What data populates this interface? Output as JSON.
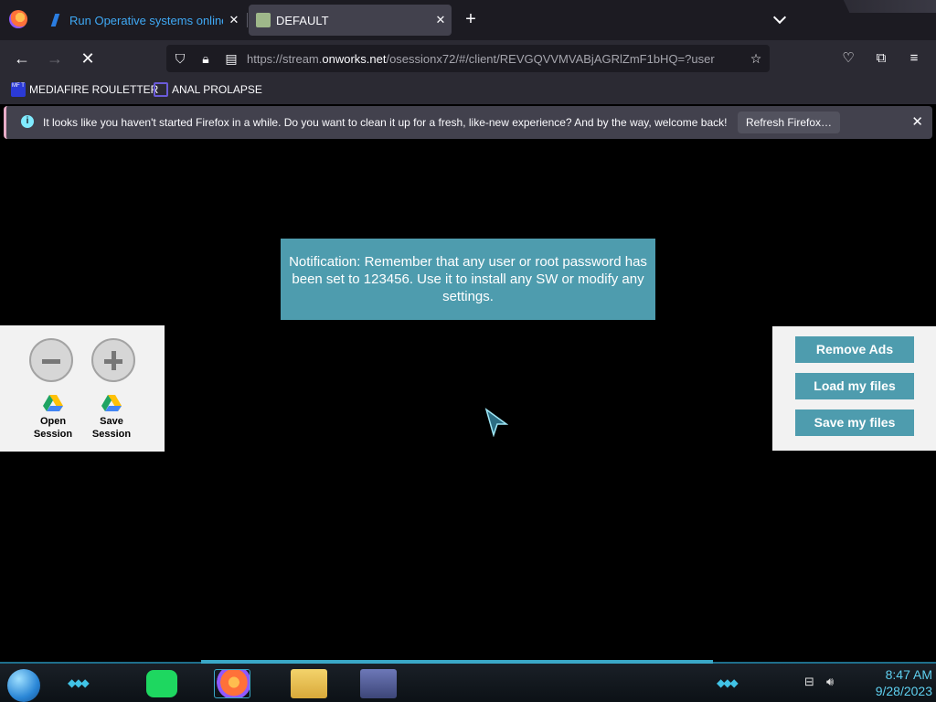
{
  "browser": {
    "tabs": [
      {
        "title": "Run Operative systems online",
        "active": false
      },
      {
        "title": "DEFAULT",
        "active": true
      }
    ],
    "new_tab": "+",
    "close_glyph": "✕",
    "url": {
      "prefix": "https://stream.",
      "domain": "onworks.net",
      "path": "/osessionx72/#/client/REVGQVVMVABjAGRlZmF1bHQ=?user"
    },
    "bookmarks": [
      {
        "label": "MEDIAFIRE ROULETTER",
        "icon": "mediafire-icon",
        "icon_text": "MF T"
      },
      {
        "label": "ANAL PROLAPSE",
        "icon": "sigma-icon"
      }
    ],
    "notification": {
      "message": "It looks like you haven't started Firefox in a while. Do you want to clean it up for a fresh, like-new experience? And by the way, welcome back!",
      "button": "Refresh Firefox…",
      "info_glyph": "i"
    }
  },
  "session": {
    "notice": "Notification: Remember that any user or root password has been set to 123456. Use it to install any SW or modify any settings.",
    "left_panel": {
      "open_label": "Open Session",
      "save_label": "Save Session"
    },
    "right_panel": {
      "buttons": [
        "Remove Ads",
        "Load my files",
        "Save my files"
      ]
    },
    "accent_color": "#4e9cae"
  },
  "taskbar": {
    "time": "8:47 AM",
    "date": "9/28/2023"
  }
}
